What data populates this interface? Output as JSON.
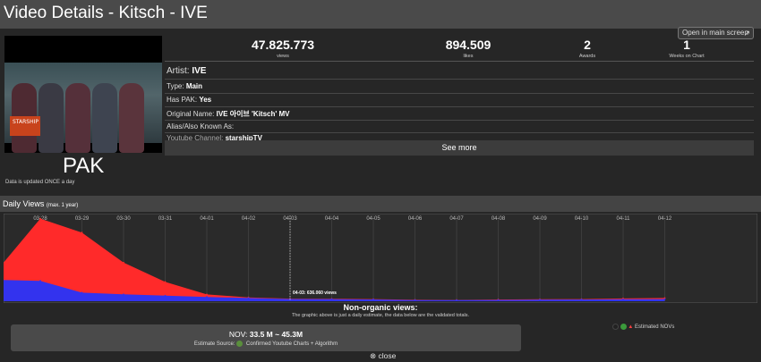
{
  "header": {
    "title": "Video Details - Kitsch - IVE"
  },
  "thumbnail": {
    "logo_text": "STARSHIP"
  },
  "pak_label": "PAK",
  "update_note": "Data is updated ONCE a day",
  "open_button": {
    "label": "Open in main screen"
  },
  "stats": [
    {
      "value": "47.825.773",
      "label": "views"
    },
    {
      "value": "894.509",
      "label": "likes"
    },
    {
      "value": "2",
      "label": "Awards"
    },
    {
      "value": "1",
      "label": "Weeks on Chart"
    }
  ],
  "info": {
    "artist_label": "Artist:",
    "artist_value": "IVE",
    "type_label": "Type:",
    "type_value": "Main",
    "haspak_label": "Has PAK:",
    "haspak_value": "Yes",
    "origname_label": "Original Name:",
    "origname_value": "IVE 아이브 'Kitsch' MV",
    "alias_label": "Alias/Also Known As:",
    "alias_value": "",
    "channel_label": "Youtube Channel:",
    "channel_value": "starshipTV"
  },
  "see_more": "See more",
  "daily_views": {
    "title": "Daily Views",
    "subtitle": "(max. 1 year)"
  },
  "chart_data": {
    "type": "area",
    "x": [
      "03-28",
      "03-29",
      "03-30",
      "03-31",
      "04-01",
      "04-02",
      "04-03",
      "04-04",
      "04-05",
      "04-06",
      "04-07",
      "04-08",
      "04-09",
      "04-10",
      "04-11",
      "04-12"
    ],
    "series": [
      {
        "name": "Estimated NOVs",
        "color": "#ff2a2a",
        "values": [
          7700000,
          6400000,
          3600000,
          1800000,
          630000,
          360000,
          240000,
          230000,
          200000,
          130000,
          120000,
          160000,
          180000,
          200000,
          260000,
          300000
        ]
      },
      {
        "name": "Views",
        "color": "#3333ee",
        "values": [
          1900000,
          800000,
          640000,
          520000,
          400000,
          300000,
          210000,
          200000,
          170000,
          110000,
          100000,
          120000,
          140000,
          160000,
          180000,
          200000
        ]
      }
    ],
    "first_value": 3600000,
    "ylim": [
      0,
      8000000
    ],
    "tooltip": {
      "x": "04-03",
      "text": "04-03: 636.060 views"
    }
  },
  "non_organic": {
    "title": "Non-organic views:",
    "subtitle": "The graphic above is just a daily estimate, the data below are the validated totals."
  },
  "nov": {
    "label": "NOV:",
    "value": "33.5 M ~ 45.3M",
    "source_label": "Estimate Source:",
    "source_value": "Confirmed Youtube Charts + Algorithm"
  },
  "legend": {
    "label": "Estimated NOVs"
  },
  "close_label": "close",
  "colors": {
    "red": "#ff2a2a",
    "blue": "#3333ee",
    "chart_bg": "#2a2a2a"
  }
}
